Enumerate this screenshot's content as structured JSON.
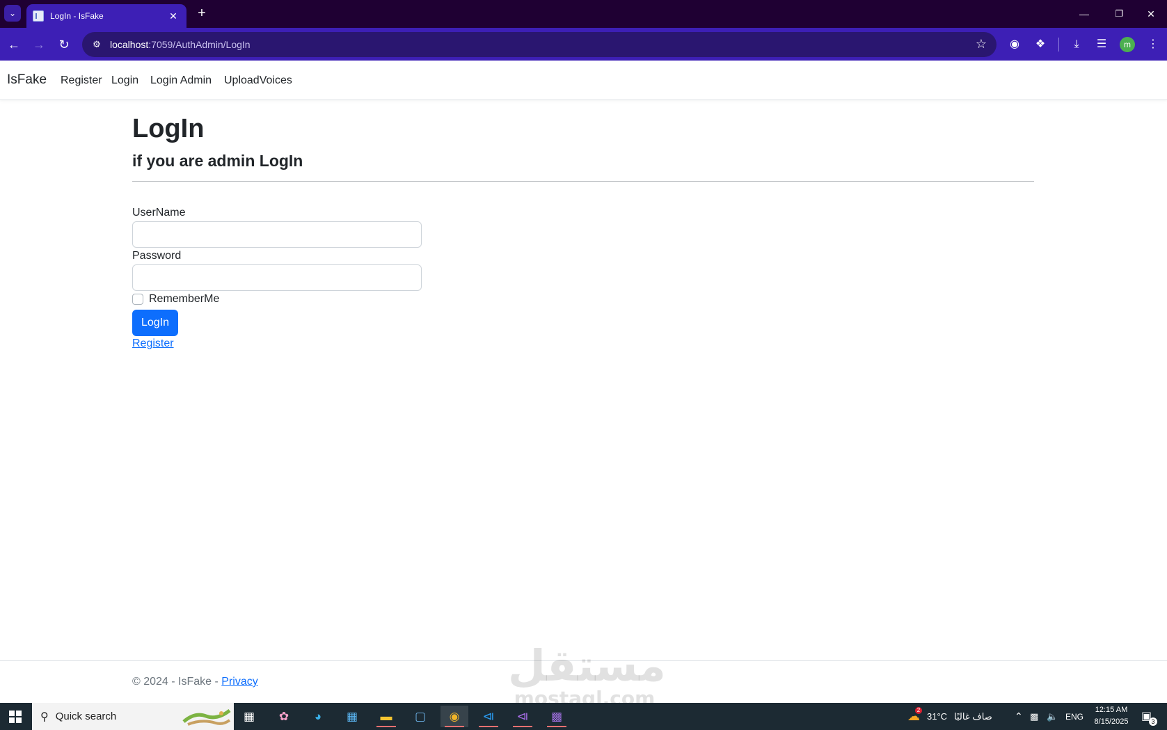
{
  "browser": {
    "tab_title": "LogIn - IsFake",
    "url_host": "localhost",
    "url_rest": ":7059/AuthAdmin/LogIn"
  },
  "site": {
    "brand": "IsFake",
    "nav": [
      {
        "label": "Register"
      },
      {
        "label": "Login"
      },
      {
        "label": "Login Admin"
      },
      {
        "label": "UploadVoices"
      }
    ]
  },
  "page": {
    "title": "LogIn",
    "subtitle": "if you are admin LogIn",
    "form": {
      "username_label": "UserName",
      "username_value": "",
      "password_label": "Password",
      "password_value": "",
      "remember_label": "RememberMe",
      "remember_checked": false,
      "submit_label": "LogIn",
      "register_link": "Register"
    }
  },
  "footer": {
    "copyright": "© 2024 - IsFake - ",
    "privacy_link": "Privacy"
  },
  "watermark": {
    "arabic": "مستقل",
    "latin": "mostaql.com"
  },
  "taskbar": {
    "search_placeholder": "Quick search",
    "weather_temp": "31°C",
    "weather_text": "صاف غالبًا",
    "weather_badge": "2",
    "language": "ENG",
    "time": "12:15 AM",
    "date": "8/15/2025",
    "notification_count": "3"
  },
  "colors": {
    "chrome_tabbar": "#1f0033",
    "chrome_toolbar": "#3d1fb5",
    "primary": "#0d6efd",
    "taskbar": "#1c2a33"
  }
}
